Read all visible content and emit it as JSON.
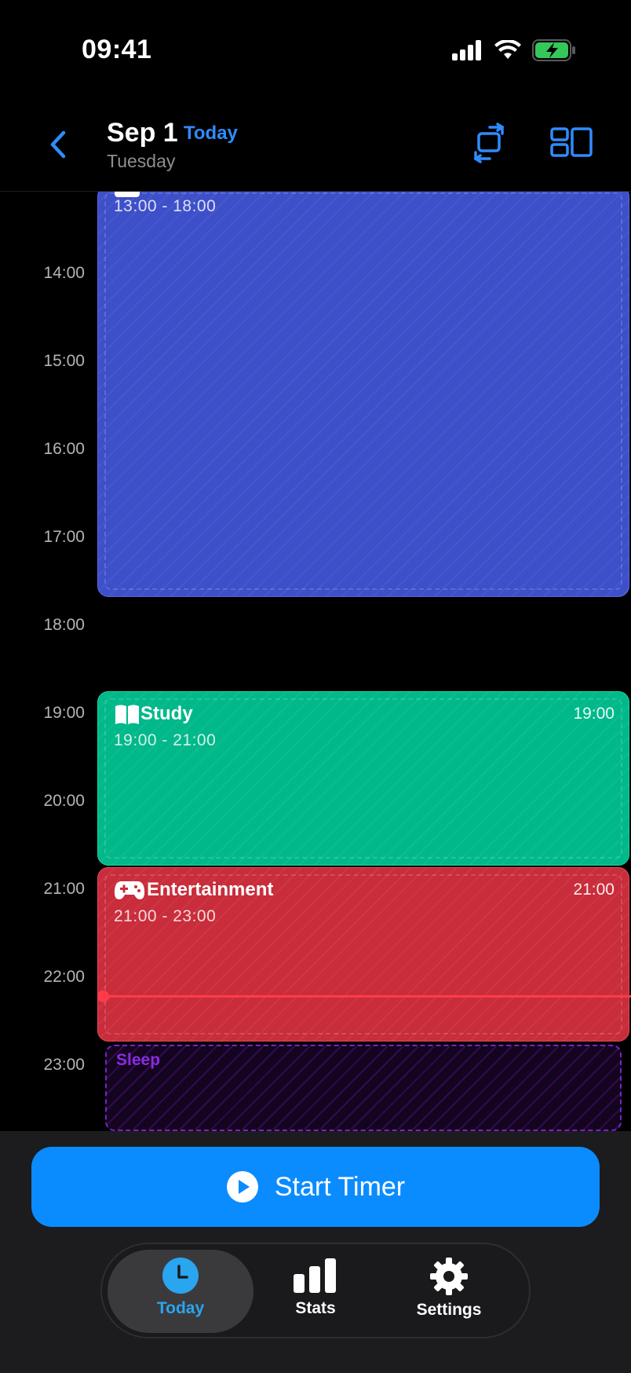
{
  "status_bar": {
    "time": "09:41",
    "icons": [
      "signal-icon",
      "wifi-icon",
      "battery-charging-icon"
    ]
  },
  "header": {
    "date": "Sep 1",
    "today_badge": "Today",
    "weekday": "Tuesday",
    "icons": [
      "back-chevron-icon",
      "swap-icon",
      "layout-icon"
    ]
  },
  "timeline": {
    "hours": [
      "14:00",
      "15:00",
      "16:00",
      "17:00",
      "18:00",
      "19:00",
      "20:00",
      "21:00",
      "22:00",
      "23:00"
    ],
    "events": {
      "work": {
        "range": "13:00 - 18:00",
        "icon": "briefcase-icon",
        "color": "#3d4fc9"
      },
      "study": {
        "title": "Study",
        "range": "19:00 - 21:00",
        "start": "19:00",
        "icon": "book-icon",
        "color": "#00b88a"
      },
      "entertainment": {
        "title": "Entertainment",
        "range": "21:00 - 23:00",
        "start": "21:00",
        "icon": "gamepad-icon",
        "color": "#c92c3a"
      },
      "sleep": {
        "title": "Sleep",
        "color": "#7a21c9"
      }
    },
    "now_color": "#ff3b47"
  },
  "start_button": {
    "label": "Start Timer",
    "icon": "play-icon",
    "color": "#0a8cff"
  },
  "tabs": [
    {
      "label": "Today",
      "icon": "clock-icon",
      "active": true
    },
    {
      "label": "Stats",
      "icon": "bar-chart-icon",
      "active": false
    },
    {
      "label": "Settings",
      "icon": "gear-icon",
      "active": false
    }
  ]
}
